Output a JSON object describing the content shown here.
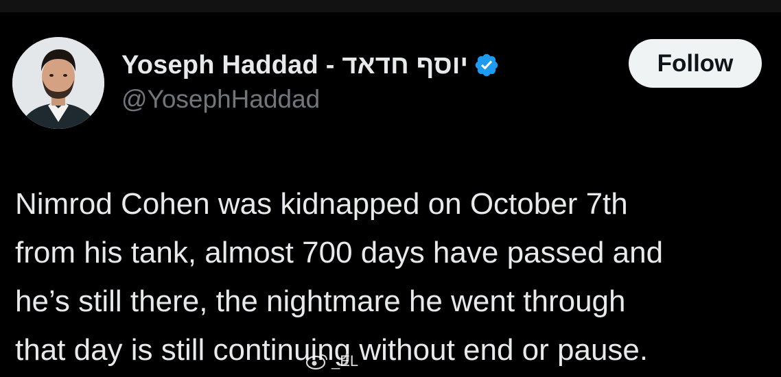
{
  "tweet": {
    "author": {
      "display_name": "Yoseph Haddad - יוסף חדאד",
      "handle": "@YosephHaddad",
      "verified": true,
      "verified_icon": "verified-badge-icon"
    },
    "follow_label": "Follow",
    "text_lines": [
      "Nimrod Cohen was kidnapped on October 7th",
      "from his tank, almost 700 days have passed and",
      "he’s still there, the nightmare he went through",
      "that day is still continuing without end or pause."
    ]
  },
  "watermark": {
    "text": "_EL",
    "icon": "weibo-logo-icon"
  },
  "colors": {
    "background": "#000000",
    "primary_text": "#e7e9ea",
    "secondary_text": "#71767b",
    "verified_blue": "#1d9bf0",
    "follow_button_bg": "#eff3f4",
    "follow_button_text": "#0f1419"
  }
}
